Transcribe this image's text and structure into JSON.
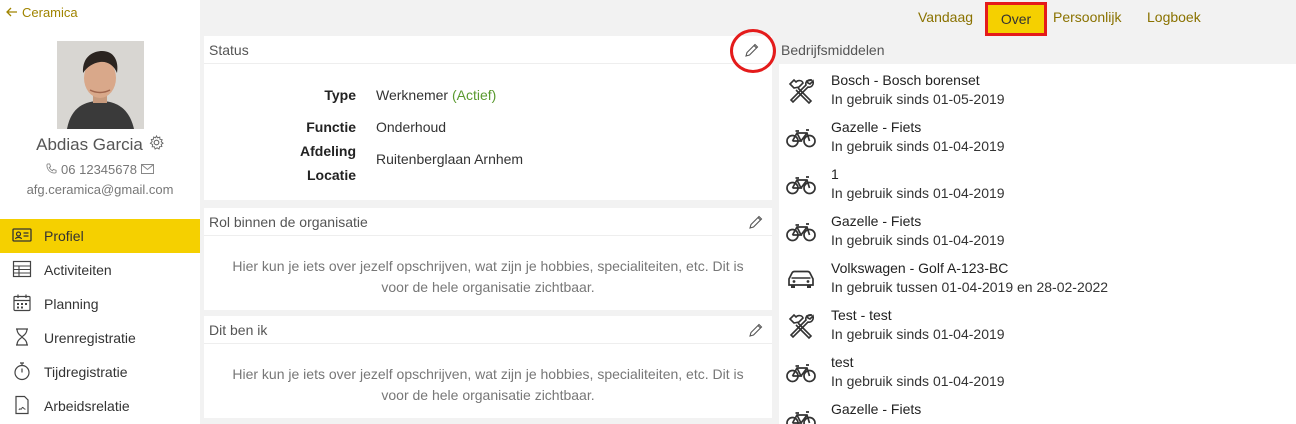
{
  "sidebar": {
    "back_label": "Ceramica",
    "user": {
      "name": "Abdias Garcia",
      "phone": "06 12345678",
      "email": "afg.ceramica@gmail.com"
    },
    "nav": [
      {
        "label": "Profiel",
        "icon": "id-card-icon",
        "active": true
      },
      {
        "label": "Activiteiten",
        "icon": "table-icon"
      },
      {
        "label": "Planning",
        "icon": "calendar-icon"
      },
      {
        "label": "Urenregistratie",
        "icon": "hourglass-icon"
      },
      {
        "label": "Tijdregistratie",
        "icon": "stopwatch-icon"
      },
      {
        "label": "Arbeidsrelatie",
        "icon": "document-icon"
      }
    ]
  },
  "topnav": {
    "vandaag": "Vandaag",
    "over": "Over",
    "persoonlijk": "Persoonlijk",
    "logboek": "Logboek"
  },
  "status": {
    "title": "Status",
    "type_label": "Type",
    "type_value": "Werknemer",
    "type_status": "(Actief)",
    "functie_label": "Functie",
    "functie_value": "Onderhoud",
    "afdeling_label": "Afdeling",
    "locatie_label": "Locatie",
    "afdeling_value": "Ruitenberglaan Arnhem"
  },
  "rol": {
    "title": "Rol binnen de organisatie",
    "text": "Hier kun je iets over jezelf opschrijven, wat zijn je hobbies, specialiteiten, etc. Dit is voor de hele organisatie zichtbaar."
  },
  "dit_ben_ik": {
    "title": "Dit ben ik",
    "text": "Hier kun je iets over jezelf opschrijven, wat zijn je hobbies, specialiteiten, etc. Dit is voor de hele organisatie zichtbaar."
  },
  "bedrijfsmiddelen": {
    "title": "Bedrijfsmiddelen",
    "items": [
      {
        "name": "Bosch - Bosch borenset",
        "since": "In gebruik sinds 01-05-2019",
        "icon": "tools-icon"
      },
      {
        "name": "Gazelle - Fiets",
        "since": "In gebruik sinds 01-04-2019",
        "icon": "bicycle-icon"
      },
      {
        "name": "1",
        "since": "In gebruik sinds 01-04-2019",
        "icon": "bicycle-icon"
      },
      {
        "name": "Gazelle - Fiets",
        "since": "In gebruik sinds 01-04-2019",
        "icon": "bicycle-icon"
      },
      {
        "name": "Volkswagen - Golf A-123-BC",
        "since": "In gebruik tussen 01-04-2019 en 28-02-2022",
        "icon": "car-icon"
      },
      {
        "name": "Test - test",
        "since": "In gebruik sinds 01-04-2019",
        "icon": "tools-icon"
      },
      {
        "name": "test",
        "since": "In gebruik sinds 01-04-2019",
        "icon": "bicycle-icon"
      },
      {
        "name": "Gazelle - Fiets",
        "since": "",
        "icon": "bicycle-icon"
      }
    ]
  }
}
